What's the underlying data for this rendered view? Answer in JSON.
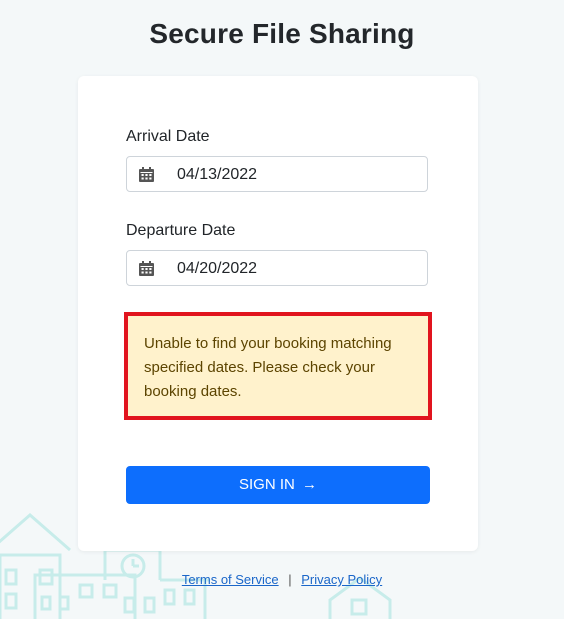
{
  "header": {
    "title": "Secure File Sharing"
  },
  "form": {
    "arrival": {
      "label": "Arrival Date",
      "value": "04/13/2022",
      "icon": "calendar-icon"
    },
    "departure": {
      "label": "Departure Date",
      "value": "04/20/2022",
      "icon": "calendar-icon"
    },
    "alert": {
      "message": "Unable to find your booking matching specified dates. Please check your booking dates."
    },
    "submit": {
      "label": "SIGN IN",
      "icon": "arrow-right-icon",
      "arrow": "→"
    }
  },
  "footer": {
    "terms_label": "Terms of Service",
    "separator": "|",
    "privacy_label": "Privacy Policy"
  },
  "colors": {
    "accent": "#0d6efd",
    "alert_bg": "#fff2cc",
    "alert_border": "#e1141e",
    "background": "#f4f8f9"
  }
}
